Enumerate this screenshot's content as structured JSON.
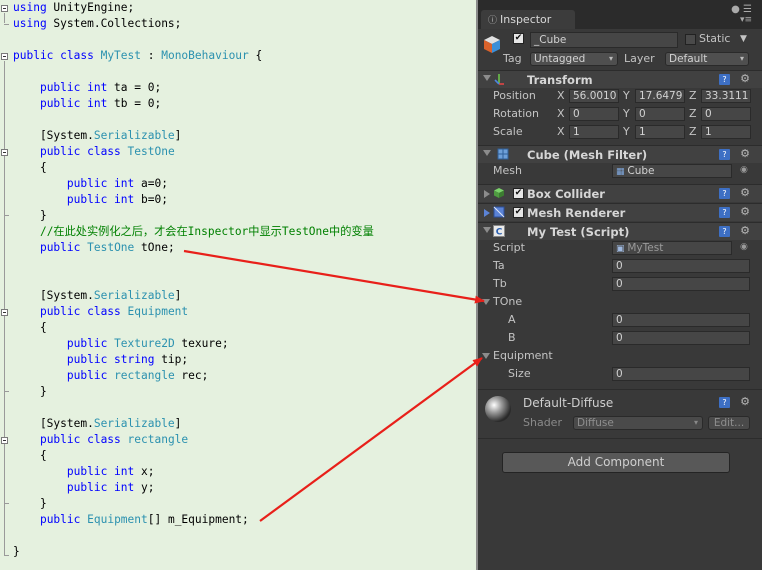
{
  "code": {
    "lines": [
      [
        {
          "c": "k",
          "t": "using"
        },
        {
          "c": "",
          "t": " UnityEngine;"
        }
      ],
      [
        {
          "c": "k",
          "t": "using"
        },
        {
          "c": "",
          "t": " System.Collections;"
        }
      ],
      [],
      [
        {
          "c": "k",
          "t": "public class"
        },
        {
          "c": "",
          "t": " "
        },
        {
          "c": "t",
          "t": "MyTest"
        },
        {
          "c": "",
          "t": " : "
        },
        {
          "c": "t",
          "t": "MonoBehaviour"
        },
        {
          "c": "",
          "t": " {"
        }
      ],
      [],
      [
        {
          "c": "",
          "t": "    "
        },
        {
          "c": "k",
          "t": "public int"
        },
        {
          "c": "",
          "t": " ta = 0;"
        }
      ],
      [
        {
          "c": "",
          "t": "    "
        },
        {
          "c": "k",
          "t": "public int"
        },
        {
          "c": "",
          "t": " tb = 0;"
        }
      ],
      [],
      [
        {
          "c": "",
          "t": "    [System."
        },
        {
          "c": "t",
          "t": "Serializable"
        },
        {
          "c": "",
          "t": "]"
        }
      ],
      [
        {
          "c": "",
          "t": "    "
        },
        {
          "c": "k",
          "t": "public class"
        },
        {
          "c": "",
          "t": " "
        },
        {
          "c": "t",
          "t": "TestOne"
        }
      ],
      [
        {
          "c": "",
          "t": "    {"
        }
      ],
      [
        {
          "c": "",
          "t": "        "
        },
        {
          "c": "k",
          "t": "public int"
        },
        {
          "c": "",
          "t": " a=0;"
        }
      ],
      [
        {
          "c": "",
          "t": "        "
        },
        {
          "c": "k",
          "t": "public int"
        },
        {
          "c": "",
          "t": " b=0;"
        }
      ],
      [
        {
          "c": "",
          "t": "    }"
        }
      ],
      [
        {
          "c": "",
          "t": "    "
        },
        {
          "c": "c",
          "t": "//在此处实例化之后，才会在Inspector中显示TestOne中的变量"
        }
      ],
      [
        {
          "c": "",
          "t": "    "
        },
        {
          "c": "k",
          "t": "public"
        },
        {
          "c": "",
          "t": " "
        },
        {
          "c": "t",
          "t": "TestOne"
        },
        {
          "c": "",
          "t": " tOne;"
        }
      ],
      [],
      [],
      [
        {
          "c": "",
          "t": "    [System."
        },
        {
          "c": "t",
          "t": "Serializable"
        },
        {
          "c": "",
          "t": "]"
        }
      ],
      [
        {
          "c": "",
          "t": "    "
        },
        {
          "c": "k",
          "t": "public class"
        },
        {
          "c": "",
          "t": " "
        },
        {
          "c": "t",
          "t": "Equipment"
        }
      ],
      [
        {
          "c": "",
          "t": "    {"
        }
      ],
      [
        {
          "c": "",
          "t": "        "
        },
        {
          "c": "k",
          "t": "public"
        },
        {
          "c": "",
          "t": " "
        },
        {
          "c": "t",
          "t": "Texture2D"
        },
        {
          "c": "",
          "t": " texure;"
        }
      ],
      [
        {
          "c": "",
          "t": "        "
        },
        {
          "c": "k",
          "t": "public string"
        },
        {
          "c": "",
          "t": " tip;"
        }
      ],
      [
        {
          "c": "",
          "t": "        "
        },
        {
          "c": "k",
          "t": "public"
        },
        {
          "c": "",
          "t": " "
        },
        {
          "c": "t",
          "t": "rectangle"
        },
        {
          "c": "",
          "t": " rec;"
        }
      ],
      [
        {
          "c": "",
          "t": "    }"
        }
      ],
      [],
      [
        {
          "c": "",
          "t": "    [System."
        },
        {
          "c": "t",
          "t": "Serializable"
        },
        {
          "c": "",
          "t": "]"
        }
      ],
      [
        {
          "c": "",
          "t": "    "
        },
        {
          "c": "k",
          "t": "public class"
        },
        {
          "c": "",
          "t": " "
        },
        {
          "c": "t",
          "t": "rectangle"
        }
      ],
      [
        {
          "c": "",
          "t": "    {"
        }
      ],
      [
        {
          "c": "",
          "t": "        "
        },
        {
          "c": "k",
          "t": "public int"
        },
        {
          "c": "",
          "t": " x;"
        }
      ],
      [
        {
          "c": "",
          "t": "        "
        },
        {
          "c": "k",
          "t": "public int"
        },
        {
          "c": "",
          "t": " y;"
        }
      ],
      [
        {
          "c": "",
          "t": "    }"
        }
      ],
      [
        {
          "c": "",
          "t": "    "
        },
        {
          "c": "k",
          "t": "public"
        },
        {
          "c": "",
          "t": " "
        },
        {
          "c": "t",
          "t": "Equipment"
        },
        {
          "c": "",
          "t": "[] m_Equipment;"
        }
      ],
      [],
      [
        {
          "c": "",
          "t": "}"
        }
      ]
    ]
  },
  "inspector": {
    "tab_label": "Inspector",
    "object": {
      "name": "_Cube",
      "active": true,
      "static_label": "Static",
      "static_checked": false
    },
    "tag_label": "Tag",
    "tag_value": "Untagged",
    "layer_label": "Layer",
    "layer_value": "Default",
    "transform": {
      "title": "Transform",
      "position_label": "Position",
      "rotation_label": "Rotation",
      "scale_label": "Scale",
      "axis_x": "X",
      "axis_y": "Y",
      "axis_z": "Z",
      "position": [
        "56.0010",
        "17.6479",
        "33.3111"
      ],
      "rotation": [
        "0",
        "0",
        "0"
      ],
      "scale": [
        "1",
        "1",
        "1"
      ]
    },
    "mesh_filter": {
      "title": "Cube (Mesh Filter)",
      "mesh_label": "Mesh",
      "mesh_value": "Cube"
    },
    "box_collider": {
      "title": "Box Collider",
      "enabled": true
    },
    "mesh_renderer": {
      "title": "Mesh Renderer",
      "enabled": true
    },
    "script": {
      "title": "My Test (Script)",
      "script_label": "Script",
      "script_value": "MyTest",
      "ta_label": "Ta",
      "ta_value": "0",
      "tb_label": "Tb",
      "tb_value": "0",
      "tone_label": "TOne",
      "a_label": "A",
      "a_value": "0",
      "b_label": "B",
      "b_value": "0",
      "equipment_label": "Equipment",
      "size_label": "Size",
      "size_value": "0"
    },
    "material": {
      "title": "Default-Diffuse",
      "shader_label": "Shader",
      "shader_value": "Diffuse",
      "edit_label": "Edit..."
    },
    "add_component_label": "Add Component"
  },
  "colors": {
    "editor_bg": "#e5f1df",
    "keyword": "#0000ff",
    "type": "#2b91af",
    "comment": "#008000",
    "inspector_bg": "#393939",
    "arrow": "#e8201a"
  }
}
